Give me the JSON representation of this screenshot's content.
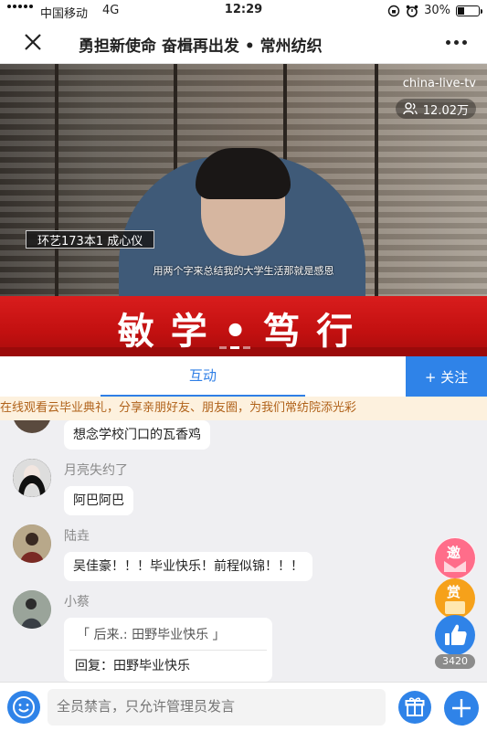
{
  "status_bar": {
    "carrier": "中国移动",
    "network": "4G",
    "time": "12:29",
    "battery": "30%",
    "battery_level": 0.3,
    "icons": [
      "signal-dots-icon",
      "rotation-lock-icon",
      "alarm-icon",
      "battery-icon"
    ]
  },
  "nav": {
    "title": "勇担新使命 奋楫再出发 • 常州纺织",
    "close_icon": "close-icon",
    "more_icon": "more-icon"
  },
  "video": {
    "watermark": "china-live-tv",
    "viewers": "12.02万",
    "nameplate": "环艺173本1  成心仪",
    "subtitle": "用两个字来总结我的大学生活那就是感恩"
  },
  "banner": {
    "text": "敏学•笃行"
  },
  "tabs": {
    "active": "互动",
    "follow": "+ 关注"
  },
  "marquee": {
    "text": "在线观看云毕业典礼，分享亲朋好友、朋友圈，为我们常纺院添光彩"
  },
  "messages": [
    {
      "user": "",
      "text": "想念学校门口的瓦香鸡"
    },
    {
      "user": "月亮失约了",
      "text": "阿巴阿巴"
    },
    {
      "user": "陆垚",
      "text": "吴佳豪！！！毕业快乐！前程似锦！！！"
    },
    {
      "user": "小蔡",
      "quote": "「 后来.: 田野毕业快乐 」",
      "reply": "回复：田野毕业快乐"
    }
  ],
  "side_buttons": {
    "invite": "邀",
    "reward": "赏",
    "like_count": "3420"
  },
  "input": {
    "placeholder": "全员禁言，只允许管理员发言"
  },
  "colors": {
    "accent": "#2f83e8",
    "banner_red": "#c21010",
    "marquee_text": "#b0621a",
    "marquee_bg": "#fdf1de"
  }
}
